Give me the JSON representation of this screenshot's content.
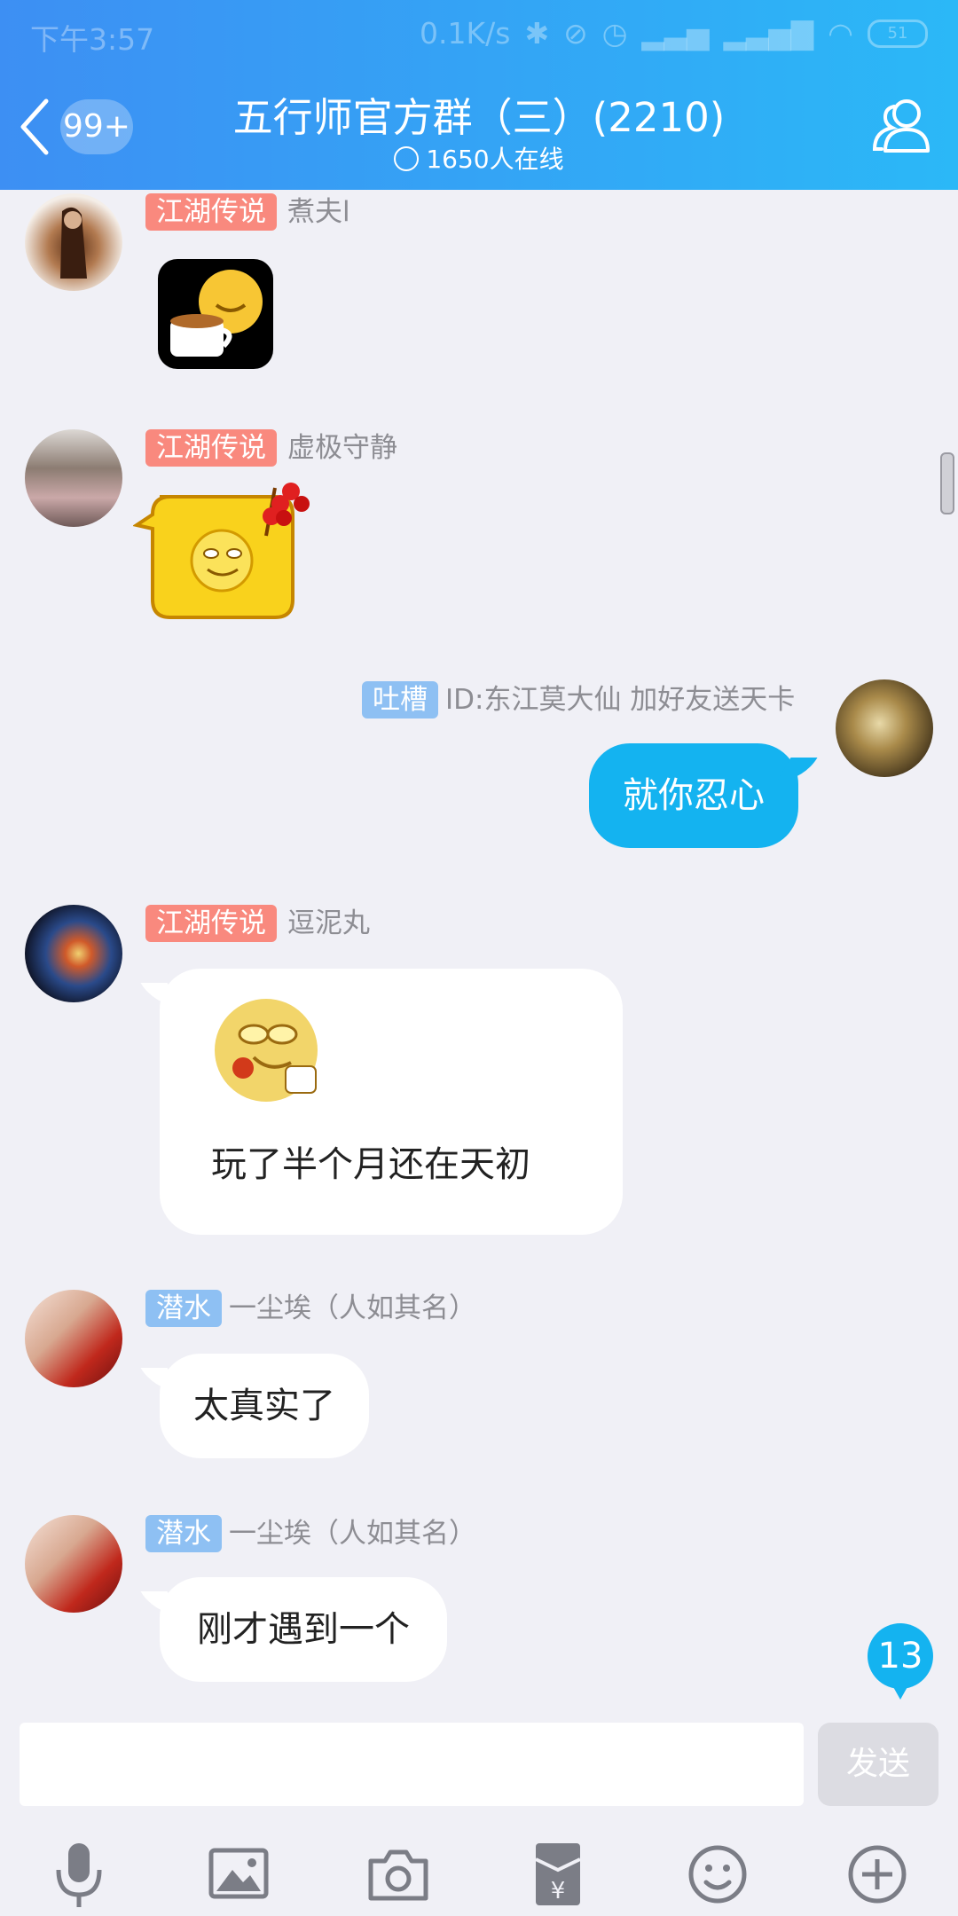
{
  "status_bar": {
    "time": "下午3:57",
    "network_speed": "0.1K/s",
    "battery": "51"
  },
  "header": {
    "unread_badge": "99+",
    "title": "五行师官方群（三）(2210)",
    "online": "1650人在线"
  },
  "messages": [
    {
      "tag": "江湖传说",
      "tag_color": "#f9897e",
      "sender": "煮夫l",
      "type": "sticker",
      "sticker": "coffee-smiley-sticker"
    },
    {
      "tag": "江湖传说",
      "tag_color": "#f9897e",
      "sender": "虚极守静",
      "type": "sticker",
      "sticker": "candied-haws-smiley-sticker"
    },
    {
      "tag": "吐槽",
      "tag_color": "#8ec0f3",
      "sender": "ID:东江莫大仙 加好友送天卡",
      "type": "text",
      "text": "就你忍心",
      "outgoing": true
    },
    {
      "tag": "江湖传说",
      "tag_color": "#f9897e",
      "sender": "逗泥丸",
      "type": "sticker+text",
      "sticker": "cartoon-emoji-sticker",
      "text": "玩了半个月还在天初"
    },
    {
      "tag": "潜水",
      "tag_color": "#8ec0f3",
      "sender": "一尘埃（人如其名）",
      "type": "text",
      "text": "太真实了"
    },
    {
      "tag": "潜水",
      "tag_color": "#8ec0f3",
      "sender": "一尘埃（人如其名）",
      "type": "text",
      "text": "刚才遇到一个"
    }
  ],
  "new_message_count": "13",
  "composer": {
    "placeholder": "",
    "send_label": "发送"
  },
  "toolbar": {
    "icons": [
      "microphone-icon",
      "image-icon",
      "camera-icon",
      "red-packet-icon",
      "emoji-icon",
      "plus-icon"
    ]
  },
  "colors": {
    "accent": "#14b3f0",
    "header_gradient_start": "#3d8ff3",
    "header_gradient_end": "#2bb8f7",
    "tag_red": "#f9897e",
    "tag_blue": "#8ec0f3"
  }
}
